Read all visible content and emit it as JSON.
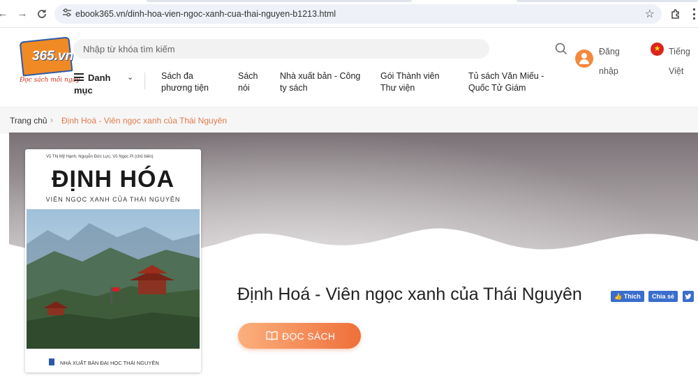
{
  "browser": {
    "url": "ebook365.vn/dinh-hoa-vien-ngoc-xanh-cua-thai-nguyen-b1213.html",
    "back_icon": "arrow-left",
    "forward_icon": "arrow-right",
    "reload_icon": "reload",
    "tune_icon": "site-settings",
    "bookmark_icon": "star",
    "extensions_icon": "puzzle",
    "menu_icon": "kebab"
  },
  "logo": {
    "text": "365.vn",
    "tagline": "Đọc sách mỗi ngày",
    "colors": {
      "orange": "#f08a24",
      "blue": "#2b59a8",
      "red": "#d0331c"
    }
  },
  "header": {
    "search_placeholder": "Nhập từ khóa tìm kiếm",
    "login_label": "Đăng nhập",
    "language_label": "Tiếng Việt",
    "accent_color": "#f4883d"
  },
  "nav": {
    "menu_label": "Danh mục",
    "items": [
      {
        "label": "Sách đa phương tiện"
      },
      {
        "label": "Sách nói"
      },
      {
        "label": "Nhà xuất bản - Công ty sách"
      },
      {
        "label": "Gói Thành viên Thư viện"
      },
      {
        "label": "Tủ sách Văn Miếu - Quốc Tử Giám"
      }
    ]
  },
  "breadcrumb": {
    "home": "Trang chủ",
    "separator": "›",
    "current": "Định Hoá - Viên ngọc xanh của Thái Nguyên"
  },
  "book": {
    "title": "Định Hoá - Viên ngọc xanh của Thái Nguyên",
    "like_label": "Thích",
    "share_label": "Chia sẻ",
    "twitter_icon": "twitter",
    "read_button_label": "ĐỌC SÁCH",
    "read_button_color": "#ef6f3a",
    "cover": {
      "authors": "Vũ Thị Mỹ Hạnh, Nguyễn Đức Lực, Vũ Ngọc Pi (chủ biên)",
      "title": "ĐỊNH HÓA",
      "subtitle": "VIÊN NGỌC XANH CỦA THÁI NGUYÊN",
      "publisher": "NHÀ XUẤT BẢN ĐẠI HỌC THÁI NGUYÊN"
    }
  }
}
